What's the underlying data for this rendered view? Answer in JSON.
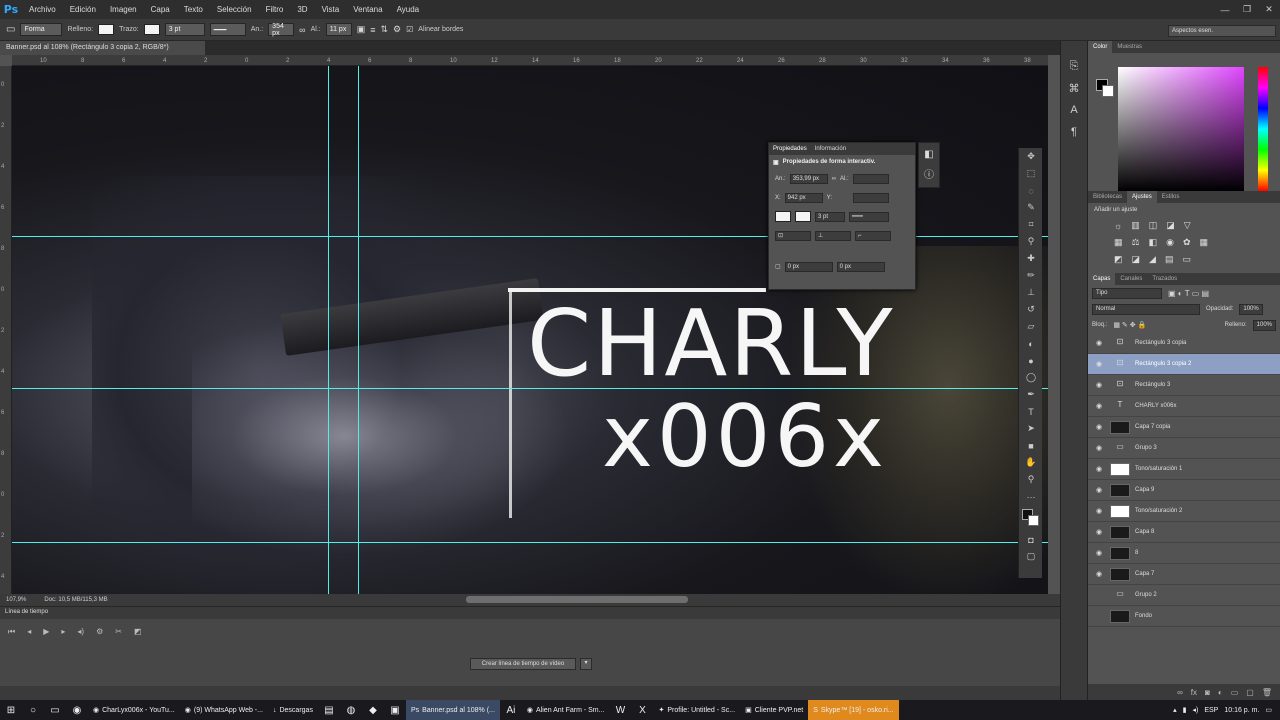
{
  "app": {
    "logo": "Ps"
  },
  "menu": [
    "Archivo",
    "Edición",
    "Imagen",
    "Capa",
    "Texto",
    "Selección",
    "Filtro",
    "3D",
    "Vista",
    "Ventana",
    "Ayuda"
  ],
  "options": {
    "mode": "Forma",
    "fill_label": "Relleno:",
    "stroke_label": "Trazo:",
    "stroke_size": "3 pt",
    "w_label": "An.:",
    "w_value": "354 px",
    "h_label": "Al.:",
    "h_value": "11 px",
    "align_edges": "Alinear bordes",
    "workspace": "Aspectos esen."
  },
  "document": {
    "tab": "Banner.psd al 108% (Rectángulo 3 copia 2, RGB/8*)",
    "zoom": "107,9%",
    "doc_info": "Doc: 10,5 MB/115,3 MB"
  },
  "ruler_top": [
    "10",
    "8",
    "6",
    "4",
    "2",
    "0",
    "2",
    "4",
    "6",
    "8",
    "10",
    "12",
    "14",
    "16",
    "18",
    "20",
    "22",
    "24",
    "26",
    "28",
    "30",
    "32",
    "34",
    "36",
    "38",
    "40",
    "42",
    "44",
    "46",
    "48",
    "50"
  ],
  "ruler_left": [
    "0",
    "2",
    "4",
    "6",
    "8",
    "0",
    "2",
    "4",
    "6",
    "8",
    "0",
    "2",
    "4"
  ],
  "canvas_text": {
    "line1": "CHARLY",
    "line2": "x006x"
  },
  "properties": {
    "tab_props": "Propiedades",
    "tab_info": "Información",
    "subtitle": "Propiedades de forma interactiv.",
    "w_label": "An.:",
    "w_value": "353,99 px",
    "h_label": "Al.:",
    "h_value": "",
    "x_label": "X:",
    "x_value": "942 px",
    "y_label": "Y:",
    "y_value": "",
    "stroke": "3 pt",
    "radius_a": "0 px",
    "radius_b": "0 px"
  },
  "timeline": {
    "title": "Línea de tiempo",
    "create_button": "Crear línea de tiempo de vídeo"
  },
  "color_panel": {
    "tabs": [
      "Color",
      "Muestras"
    ]
  },
  "adjust_panel": {
    "tabs": [
      "Bibliotecas",
      "Ajustes",
      "Estilos"
    ],
    "title": "Añadir un ajuste"
  },
  "layers_panel": {
    "tabs": [
      "Capas",
      "Canales",
      "Trazados"
    ],
    "filter": "Tipo",
    "blend": "Normal",
    "opacity_label": "Opacidad:",
    "opacity": "100%",
    "lock_label": "Bloq.:",
    "fill_label": "Relleno:",
    "fill": "100%",
    "layers": [
      {
        "name": "Rectángulo 3 copia",
        "thumb": "shape",
        "visible": true,
        "selected": false
      },
      {
        "name": "Rectángulo 3 copia 2",
        "thumb": "shape",
        "visible": true,
        "selected": true
      },
      {
        "name": "Rectángulo 3",
        "thumb": "shape",
        "visible": true,
        "selected": false
      },
      {
        "name": "CHARLY  x006x",
        "thumb": "text",
        "visible": true,
        "selected": false
      },
      {
        "name": "Capa 7 copia",
        "thumb": "dark",
        "visible": true,
        "selected": false
      },
      {
        "name": "Grupo 3",
        "thumb": "folder",
        "visible": true,
        "selected": false
      },
      {
        "name": "Tono/saturación 1",
        "thumb": "white",
        "visible": true,
        "selected": false
      },
      {
        "name": "Capa 9",
        "thumb": "dark",
        "visible": true,
        "selected": false
      },
      {
        "name": "Tono/saturación 2",
        "thumb": "white",
        "visible": true,
        "selected": false
      },
      {
        "name": "Capa 8",
        "thumb": "dark",
        "visible": true,
        "selected": false
      },
      {
        "name": "8",
        "thumb": "dark",
        "visible": true,
        "selected": false
      },
      {
        "name": "Capa 7",
        "thumb": "dark",
        "visible": true,
        "selected": false
      },
      {
        "name": "Grupo 2",
        "thumb": "folder",
        "visible": false,
        "selected": false
      },
      {
        "name": "Fondo",
        "thumb": "dark",
        "visible": false,
        "selected": false
      }
    ]
  },
  "taskbar": {
    "tasks": [
      "CharLyx006x - YouTu...",
      "(9) WhatsApp Web -...",
      "Descargas",
      "Banner.psd al 108% (...",
      "Alien Ant Farm - Sm...",
      "Profile: Untitled - Sc...",
      "Cliente PVP.net",
      "Skype™ [19] - osko.ri..."
    ],
    "lang": "ESP",
    "time": "10:16 p. m."
  },
  "colors": {
    "guide": "#4ff0ea",
    "selected_layer": "#8da0c4",
    "ps_blue": "#31a8ff"
  }
}
